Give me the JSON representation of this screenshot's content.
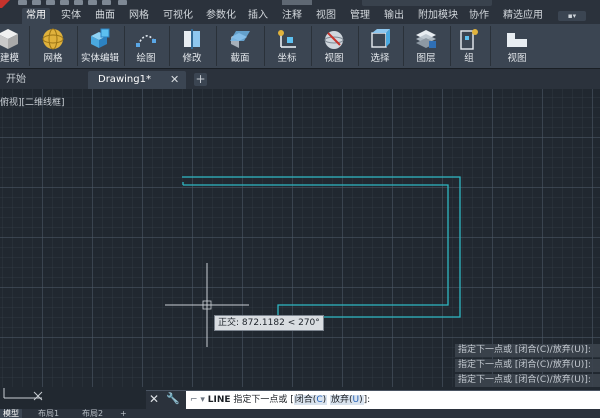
{
  "quick_access": {
    "search_placeholder": ""
  },
  "ribbon_tabs": [
    "常用",
    "实体",
    "曲面",
    "网格",
    "可视化",
    "参数化",
    "插入",
    "注释",
    "视图",
    "管理",
    "输出",
    "附加模块",
    "协作",
    "精选应用"
  ],
  "active_ribbon_tab": "常用",
  "workspace_dropdown": "▪▾",
  "ribbon_buttons": [
    {
      "label": "建模",
      "icon": "cube-icon"
    },
    {
      "label": "网格",
      "icon": "mesh-sphere-icon"
    },
    {
      "label": "实体编辑",
      "icon": "solid-edit-icon"
    },
    {
      "label": "绘图",
      "icon": "draw-arc-icon"
    },
    {
      "label": "修改",
      "icon": "modify-icon"
    },
    {
      "label": "截面",
      "icon": "section-plane-icon"
    },
    {
      "label": "坐标",
      "icon": "ucs-coordinates-icon"
    },
    {
      "label": "视图",
      "icon": "view-sphere-icon"
    },
    {
      "label": "选择",
      "icon": "selection-cube-icon"
    },
    {
      "label": "图层",
      "icon": "layers-icon"
    },
    {
      "label": "组",
      "icon": "group-icon"
    },
    {
      "label": "视图",
      "icon": "view-icon"
    }
  ],
  "doc_tabs": {
    "start": "开始",
    "active": "Drawing1*",
    "close_glyph": "✕",
    "new_glyph": "+"
  },
  "viewport": {
    "label": "俯视][二维线框]"
  },
  "ortho_tooltip": "正交: 872.1182 < 270°",
  "command_history": [
    "指定下一点或 [闭合(C)/放弃(U)]:",
    "指定下一点或 [闭合(C)/放弃(U)]:",
    "指定下一点或 [闭合(C)/放弃(U)]:"
  ],
  "command_line": {
    "close_glyph": "✕",
    "tool_glyph": "🔧",
    "prompt_icon": "⌐ ▾",
    "command": "LINE",
    "text": " 指定下一点或 [",
    "option1_text": "闭合(",
    "option1_key": "C",
    "option1_end": ")",
    "option2_text": "放弃(",
    "option2_key": "U",
    "option2_end": ")",
    "suffix": "]:"
  },
  "layout_tabs": [
    "模型",
    "布局1",
    "布局2",
    "+"
  ],
  "colors": {
    "polyline": "#2fb8c4",
    "crosshair": "#c9ced4",
    "canvas": "#212830",
    "ribbon": "#3b4552"
  }
}
